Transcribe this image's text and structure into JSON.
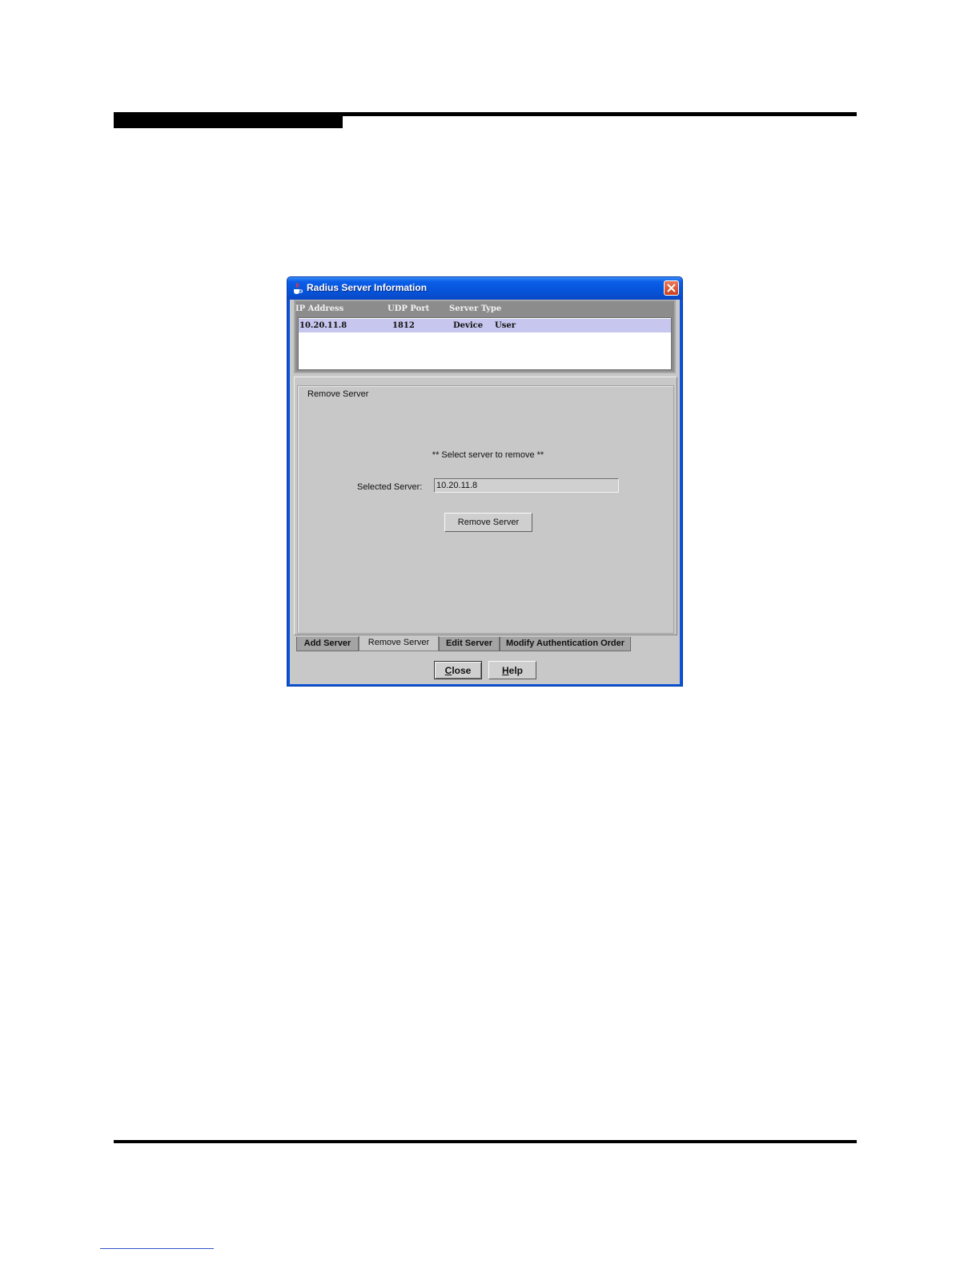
{
  "window": {
    "title": "Radius Server Information",
    "icon": "java-cup-icon"
  },
  "table": {
    "columns": [
      "IP Address",
      "UDP Port",
      "Server Type"
    ],
    "rows": [
      {
        "ip": "10.20.11.8",
        "port": "1812",
        "type_device": "Device",
        "type_user": "User"
      }
    ]
  },
  "panel": {
    "group_label": "Remove Server",
    "hint": "** Select server to remove **",
    "selected_label": "Selected Server:",
    "selected_value": "10.20.11.8",
    "remove_button": "Remove Server"
  },
  "tabs": [
    {
      "label": "Add Server",
      "active": false
    },
    {
      "label": "Remove Server",
      "active": true
    },
    {
      "label": "Edit Server",
      "active": false
    },
    {
      "label": "Modify Authentication Order",
      "active": false
    }
  ],
  "buttons": {
    "close_mnemonic": "C",
    "close_rest": "lose",
    "help_mnemonic": "H",
    "help_rest": "elp"
  },
  "colors": {
    "titlebar": "#0652d6",
    "selected_row": "#c6c6ee",
    "dialog_bg": "#c8c8c8"
  }
}
